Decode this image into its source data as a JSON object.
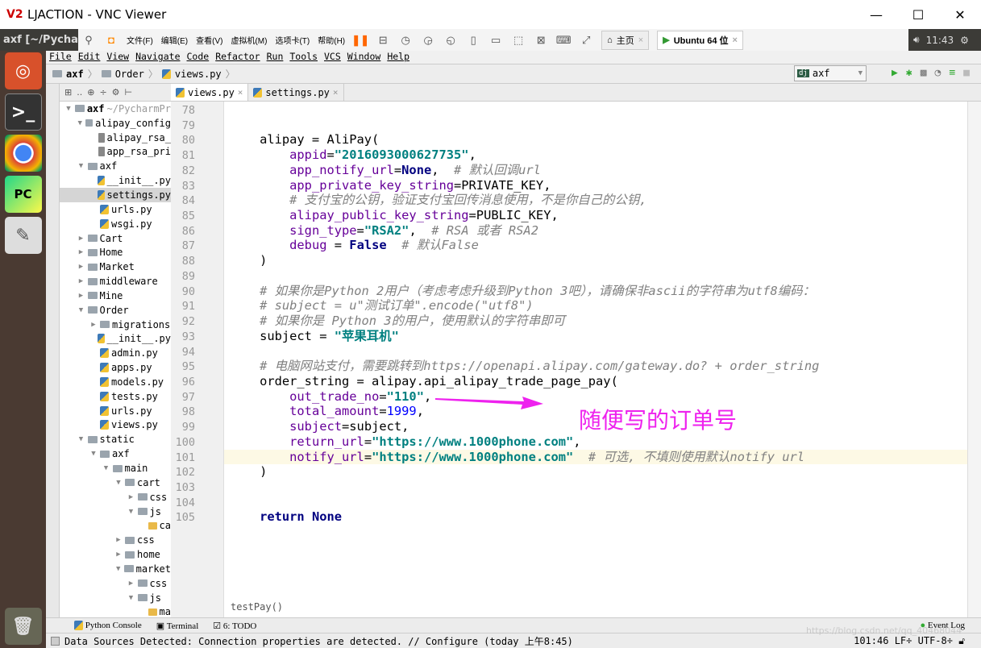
{
  "window": {
    "title": "LJACTION - VNC Viewer",
    "logo": "V2",
    "buttons": [
      "minimize-icon",
      "maximize-icon",
      "close-icon"
    ]
  },
  "ubuntu": {
    "app_title": "axf [~/Pycharm",
    "clock": "11:43"
  },
  "vnc_toolbar": {
    "menus": [
      "文件(F)",
      "编辑(E)",
      "查看(V)",
      "虚拟机(M)",
      "选项卡(T)",
      "帮助(H)"
    ],
    "tabs": [
      {
        "label": "主页"
      },
      {
        "label": "Ubuntu 64 位"
      }
    ]
  },
  "menubar": [
    "File",
    "Edit",
    "View",
    "Navigate",
    "Code",
    "Refactor",
    "Run",
    "Tools",
    "VCS",
    "Window",
    "Help"
  ],
  "breadcrumb": [
    "axf",
    "Order",
    "views.py"
  ],
  "run_config": "axf",
  "project_toolbar": "..",
  "editor_tabs": [
    {
      "label": "views.py",
      "active": true
    },
    {
      "label": "settings.py",
      "active": false
    }
  ],
  "tree": [
    {
      "d": 0,
      "t": "axf",
      "extra": " ~/PycharmPr",
      "k": "folder",
      "a": "down",
      "bold": true
    },
    {
      "d": 1,
      "t": "alipay_config",
      "k": "folder",
      "a": "down"
    },
    {
      "d": 2,
      "t": "alipay_rsa_",
      "k": "file"
    },
    {
      "d": 2,
      "t": "app_rsa_pri",
      "k": "file"
    },
    {
      "d": 1,
      "t": "axf",
      "k": "folder",
      "a": "down"
    },
    {
      "d": 2,
      "t": "__init__.py",
      "k": "py"
    },
    {
      "d": 2,
      "t": "settings.py",
      "k": "py",
      "sel": true
    },
    {
      "d": 2,
      "t": "urls.py",
      "k": "py"
    },
    {
      "d": 2,
      "t": "wsgi.py",
      "k": "py"
    },
    {
      "d": 1,
      "t": "Cart",
      "k": "folder",
      "a": "right"
    },
    {
      "d": 1,
      "t": "Home",
      "k": "folder",
      "a": "right"
    },
    {
      "d": 1,
      "t": "Market",
      "k": "folder",
      "a": "right"
    },
    {
      "d": 1,
      "t": "middleware",
      "k": "folder",
      "a": "right"
    },
    {
      "d": 1,
      "t": "Mine",
      "k": "folder",
      "a": "right"
    },
    {
      "d": 1,
      "t": "Order",
      "k": "folder",
      "a": "down"
    },
    {
      "d": 2,
      "t": "migrations",
      "k": "folder",
      "a": "right"
    },
    {
      "d": 2,
      "t": "__init__.py",
      "k": "py"
    },
    {
      "d": 2,
      "t": "admin.py",
      "k": "py"
    },
    {
      "d": 2,
      "t": "apps.py",
      "k": "py"
    },
    {
      "d": 2,
      "t": "models.py",
      "k": "py"
    },
    {
      "d": 2,
      "t": "tests.py",
      "k": "py"
    },
    {
      "d": 2,
      "t": "urls.py",
      "k": "py"
    },
    {
      "d": 2,
      "t": "views.py",
      "k": "py"
    },
    {
      "d": 1,
      "t": "static",
      "k": "folder",
      "a": "down"
    },
    {
      "d": 2,
      "t": "axf",
      "k": "folder",
      "a": "down"
    },
    {
      "d": 3,
      "t": "main",
      "k": "folder",
      "a": "down"
    },
    {
      "d": 4,
      "t": "cart",
      "k": "folder",
      "a": "down"
    },
    {
      "d": 5,
      "t": "css",
      "k": "folder",
      "a": "right"
    },
    {
      "d": 5,
      "t": "js",
      "k": "folder",
      "a": "down"
    },
    {
      "d": 6,
      "t": "ca",
      "k": "js"
    },
    {
      "d": 4,
      "t": "css",
      "k": "folder",
      "a": "right"
    },
    {
      "d": 4,
      "t": "home",
      "k": "folder",
      "a": "right"
    },
    {
      "d": 4,
      "t": "market",
      "k": "folder",
      "a": "down"
    },
    {
      "d": 5,
      "t": "css",
      "k": "folder",
      "a": "right"
    },
    {
      "d": 5,
      "t": "js",
      "k": "folder",
      "a": "down"
    },
    {
      "d": 6,
      "t": "ma",
      "k": "js"
    }
  ],
  "code": {
    "first_line": 78,
    "current_line": 101,
    "lines": [
      [],
      [],
      [
        [
          "",
          "    alipay = AliPay("
        ]
      ],
      [
        [
          "",
          "        "
        ],
        [
          "par",
          "appid"
        ],
        [
          "",
          "="
        ],
        [
          "str",
          "\"2016093000627735\""
        ],
        [
          "",
          ","
        ]
      ],
      [
        [
          "",
          "        "
        ],
        [
          "par",
          "app_notify_url"
        ],
        [
          "",
          "="
        ],
        [
          "kw",
          "None"
        ],
        [
          "",
          ",  "
        ],
        [
          "cm",
          "# 默认回调url"
        ]
      ],
      [
        [
          "",
          "        "
        ],
        [
          "par",
          "app_private_key_string"
        ],
        [
          "",
          "=PRIVATE_KEY,"
        ]
      ],
      [
        [
          "",
          "        "
        ],
        [
          "cm",
          "# 支付宝的公钥，验证支付宝回传消息使用，不是你自己的公钥,"
        ]
      ],
      [
        [
          "",
          "        "
        ],
        [
          "par",
          "alipay_public_key_string"
        ],
        [
          "",
          "=PUBLIC_KEY,"
        ]
      ],
      [
        [
          "",
          "        "
        ],
        [
          "par",
          "sign_type"
        ],
        [
          "",
          "="
        ],
        [
          "str",
          "\"RSA2\""
        ],
        [
          "",
          ",  "
        ],
        [
          "cm",
          "# RSA 或者 RSA2"
        ]
      ],
      [
        [
          "",
          "        "
        ],
        [
          "par",
          "debug"
        ],
        [
          "",
          " = "
        ],
        [
          "kw",
          "False"
        ],
        [
          "",
          "  "
        ],
        [
          "cm",
          "# 默认False"
        ]
      ],
      [
        [
          "",
          "    )"
        ]
      ],
      [],
      [
        [
          "",
          "    "
        ],
        [
          "cm",
          "# 如果你是Python 2用户（考虑考虑升级到Python 3吧），请确保非ascii的字符串为utf8编码："
        ]
      ],
      [
        [
          "",
          "    "
        ],
        [
          "cm",
          "# subject = u\"测试订单\".encode(\"utf8\")"
        ]
      ],
      [
        [
          "",
          "    "
        ],
        [
          "cm",
          "# 如果你是 Python 3的用户，使用默认的字符串即可"
        ]
      ],
      [
        [
          "",
          "    subject = "
        ],
        [
          "str",
          "\"苹果耳机\""
        ]
      ],
      [],
      [
        [
          "",
          "    "
        ],
        [
          "cm",
          "# 电脑网站支付，需要跳转到https://openapi.alipay.com/gateway.do? + order_string"
        ]
      ],
      [
        [
          "",
          "    order_string = alipay.api_alipay_trade_page_pay("
        ]
      ],
      [
        [
          "",
          "        "
        ],
        [
          "par",
          "out_trade_no"
        ],
        [
          "",
          "="
        ],
        [
          "str",
          "\"110\""
        ],
        [
          "",
          ","
        ]
      ],
      [
        [
          "",
          "        "
        ],
        [
          "par",
          "total_amount"
        ],
        [
          "",
          "="
        ],
        [
          "num",
          "1999"
        ],
        [
          "",
          ","
        ]
      ],
      [
        [
          "",
          "        "
        ],
        [
          "par",
          "subject"
        ],
        [
          "",
          "=subject,"
        ]
      ],
      [
        [
          "",
          "        "
        ],
        [
          "par",
          "return_url"
        ],
        [
          "",
          "="
        ],
        [
          "str",
          "\"https://www.1000phone.com\""
        ],
        [
          "",
          ","
        ]
      ],
      [
        [
          "",
          "        "
        ],
        [
          "par",
          "notify_url"
        ],
        [
          "",
          "="
        ],
        [
          "str",
          "\"https://www.1000phone.com\""
        ],
        [
          "",
          "  "
        ],
        [
          "cm",
          "# 可选, 不填则使用默认notify url"
        ]
      ],
      [
        [
          "",
          "    )"
        ]
      ],
      [],
      [],
      [
        [
          "",
          "    "
        ],
        [
          "kw",
          "return None"
        ]
      ]
    ]
  },
  "annotation": "随便写的订单号",
  "annotation_color": "#ee22ee",
  "editor_breadcrumb": "testPay()",
  "tool_windows": [
    "Python Console",
    "Terminal",
    "6: TODO",
    "Event Log"
  ],
  "status": {
    "message": "Data Sources Detected: Connection properties are detected. // Configure (today 上午8:45)",
    "position": "101:46",
    "line_sep": "LF÷",
    "encoding": "UTF-8÷"
  },
  "watermark": "https://blog.csdn.net/qq_40468044"
}
